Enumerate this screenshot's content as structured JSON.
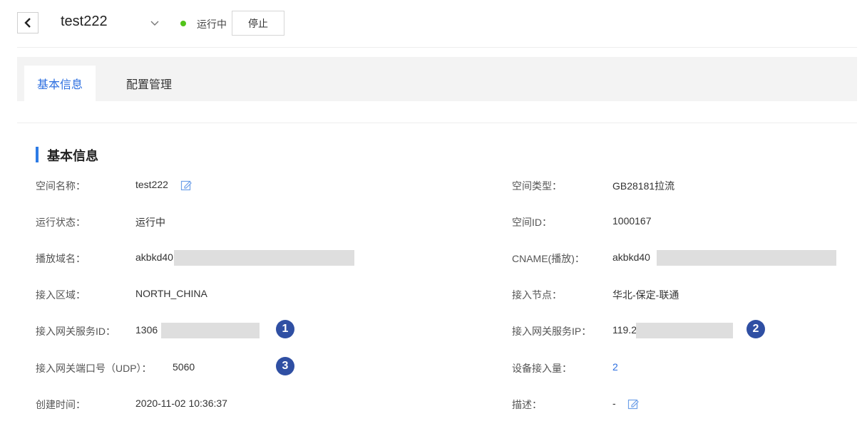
{
  "header": {
    "instance_name": "test222",
    "status_text": "运行中",
    "stop_label": "停止",
    "status_color": "#52c41a"
  },
  "tabs": [
    {
      "label": "基本信息",
      "active": true
    },
    {
      "label": "配置管理",
      "active": false
    }
  ],
  "section": {
    "title": "基本信息",
    "accent_color": "#2d7be5"
  },
  "left_fields": [
    {
      "label": "空间名称：",
      "value": "test222"
    },
    {
      "label": "运行状态：",
      "value": "运行中"
    },
    {
      "label": "播放域名：",
      "value": "akbkd40"
    },
    {
      "label": "接入区域：",
      "value": "NORTH_CHINA"
    },
    {
      "label": "接入网关服务ID：",
      "value": "1306"
    },
    {
      "label": "接入网关端口号（UDP）：",
      "value": "5060"
    },
    {
      "label": "创建时间：",
      "value": "2020-11-02 10:36:37"
    }
  ],
  "right_fields": [
    {
      "label": "空间类型：",
      "value": "GB28181拉流"
    },
    {
      "label": "空间ID：",
      "value": "1000167"
    },
    {
      "label": "CNAME(播放)：",
      "value": "akbkd40"
    },
    {
      "label": "接入节点：",
      "value": "华北-保定-联通"
    },
    {
      "label": "接入网关服务IP：",
      "value": "119.2"
    },
    {
      "label": "设备接入量：",
      "value": "2"
    },
    {
      "label": "描述：",
      "value": "-"
    }
  ],
  "badges": [
    "1",
    "2",
    "3"
  ],
  "icons": {
    "back": "chevron-left-icon",
    "dropdown": "chevron-down-icon",
    "edit": "edit-icon"
  }
}
